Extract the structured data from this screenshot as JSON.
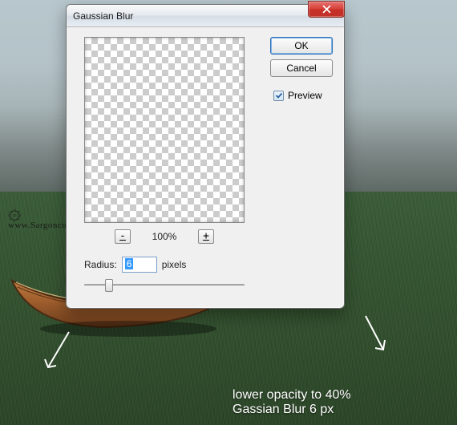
{
  "dialog": {
    "title": "Gaussian Blur",
    "ok_label": "OK",
    "cancel_label": "Cancel",
    "preview_label": "Preview",
    "preview_checked": true,
    "zoom_out_label": "-",
    "zoom_in_label": "+",
    "zoom_percent": "100%",
    "radius_label": "Radius:",
    "radius_value": "6",
    "radius_units": "pixels"
  },
  "watermark": {
    "text": "www.Sargonco.com"
  },
  "annotation": {
    "line1": "lower opacity to 40%",
    "line2": "Gassian Blur 6 px"
  }
}
